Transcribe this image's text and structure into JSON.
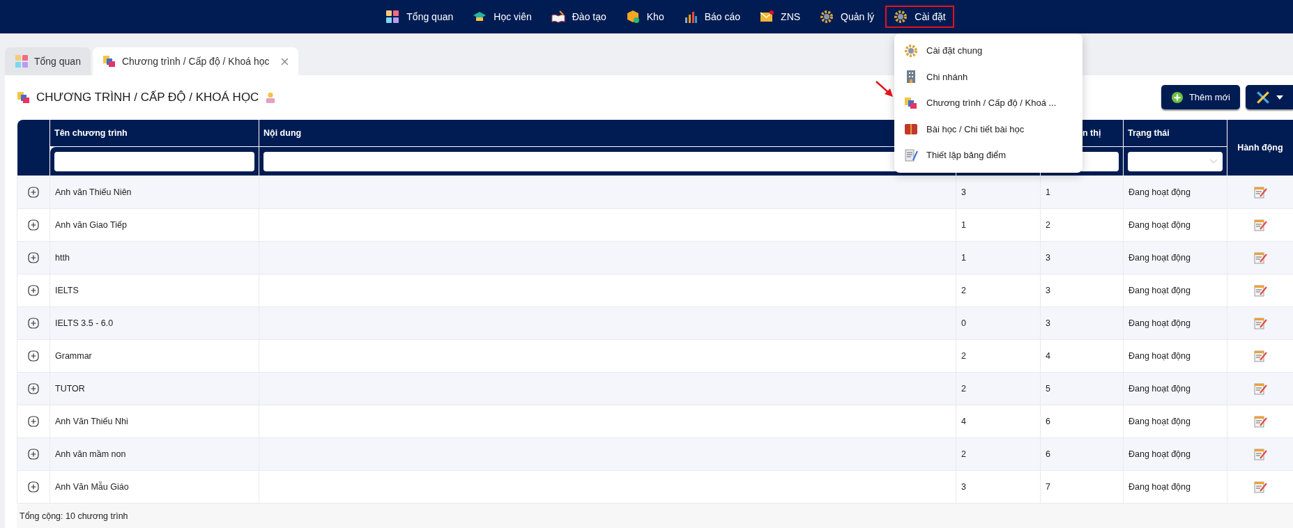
{
  "navbar": {
    "items": [
      {
        "label": "Tổng quan",
        "selected": false
      },
      {
        "label": "Học viên",
        "selected": false
      },
      {
        "label": "Đào tạo",
        "selected": false
      },
      {
        "label": "Kho",
        "selected": false
      },
      {
        "label": "Báo cáo",
        "selected": false
      },
      {
        "label": "ZNS",
        "selected": false
      },
      {
        "label": "Quản lý",
        "selected": false
      },
      {
        "label": "Cài đặt",
        "selected": true
      }
    ]
  },
  "dropdown": {
    "items": [
      "Cài đặt chung",
      "Chi nhánh",
      "Chương trình / Cấp độ / Khoá ...",
      "Bài học / Chi tiết bài học",
      "Thiết lập bảng điểm"
    ]
  },
  "tabs": [
    {
      "label": "Tổng quan",
      "selected": false,
      "closable": false
    },
    {
      "label": "Chương trình / Cấp độ / Khoá học",
      "selected": true,
      "closable": true
    }
  ],
  "page_title": "CHƯƠNG TRÌNH / CẤP ĐỘ / KHOÁ HỌC",
  "buttons": {
    "add": "Thêm mới"
  },
  "table": {
    "columns": [
      {
        "label": "Tên chương trình",
        "kind": "text"
      },
      {
        "label": "Nội dung",
        "kind": "text"
      },
      {},
      {
        "label": "n thị",
        "kind": "text"
      },
      {
        "label": "Trạng thái",
        "kind": "select"
      }
    ],
    "action_header": "Hành động",
    "rows": [
      {
        "name": "Anh văn Thiếu Niên",
        "column_4": "3",
        "column_5": "1",
        "status": "Đang hoạt động"
      },
      {
        "name": "Anh văn Giao Tiếp",
        "column_4": "1",
        "column_5": "2",
        "status": "Đang hoạt động"
      },
      {
        "name": "htth",
        "column_4": "1",
        "column_5": "3",
        "status": "Đang hoạt động"
      },
      {
        "name": "IELTS",
        "column_4": "2",
        "column_5": "3",
        "status": "Đang hoạt động"
      },
      {
        "name": "IELTS 3.5 - 6.0",
        "column_4": "0",
        "column_5": "3",
        "status": "Đang hoạt động"
      },
      {
        "name": "Grammar",
        "column_4": "2",
        "column_5": "4",
        "status": "Đang hoạt động"
      },
      {
        "name": "TUTOR",
        "column_4": "2",
        "column_5": "5",
        "status": "Đang hoạt động"
      },
      {
        "name": "Anh Văn Thiếu Nhi",
        "column_4": "4",
        "column_5": "6",
        "status": "Đang hoạt động"
      },
      {
        "name": "Anh văn mầm non",
        "column_4": "2",
        "column_5": "6",
        "status": "Đang hoạt động"
      },
      {
        "name": "Anh Văn Mẫu Giáo",
        "column_4": "3",
        "column_5": "7",
        "status": "Đang hoạt động"
      }
    ],
    "footer": "Tổng cộng: 10 chương trình"
  }
}
